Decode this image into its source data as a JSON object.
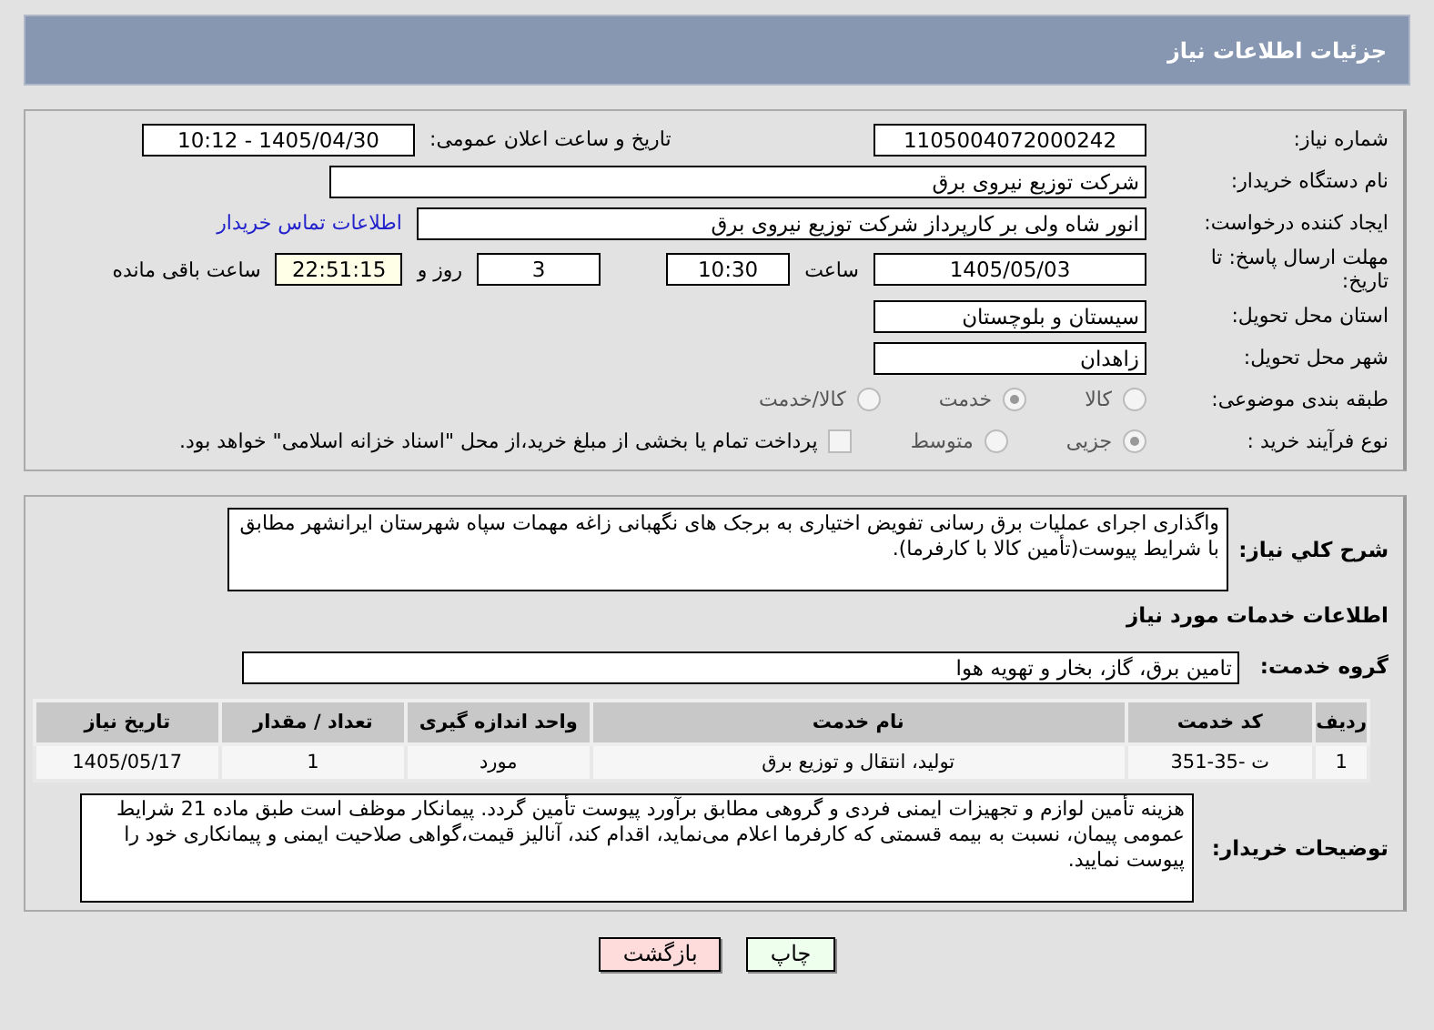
{
  "header": {
    "title": "جزئیات اطلاعات نیاز"
  },
  "need_number": {
    "label": "شماره نیاز:",
    "value": "1105004072000242"
  },
  "announce": {
    "label": "تاریخ و ساعت اعلان عمومی:",
    "value": "1405/04/30 - 10:12"
  },
  "buyer": {
    "label": "نام دستگاه خریدار:",
    "value": "شرکت توزیع نیروی برق"
  },
  "creator": {
    "label": "ایجاد کننده درخواست:",
    "value": "انور شاه ولی بر کارپرداز شرکت توزیع نیروی برق",
    "link": "اطلاعات تماس خریدار"
  },
  "deadline": {
    "label": "مهلت ارسال پاسخ: تا تاریخ:",
    "date": "1405/05/03",
    "time_label": "ساعت",
    "time": "10:30",
    "days": "3",
    "days_label": "روز و",
    "remaining": "22:51:15",
    "remaining_label": "ساعت باقی مانده"
  },
  "province": {
    "label": "استان محل تحویل:",
    "value": "سیستان و بلوچستان"
  },
  "city": {
    "label": "شهر محل تحویل:",
    "value": "زاهدان"
  },
  "category": {
    "label": "طبقه بندی موضوعی:",
    "options": [
      {
        "label": "کالا",
        "selected": false
      },
      {
        "label": "خدمت",
        "selected": true
      },
      {
        "label": "کالا/خدمت",
        "selected": false
      }
    ]
  },
  "process": {
    "label": "نوع فرآیند خرید :",
    "options": [
      {
        "label": "جزیی",
        "selected": true
      },
      {
        "label": "متوسط",
        "selected": false
      }
    ],
    "payment": {
      "label": "پرداخت تمام یا بخشی از مبلغ خرید،از محل \"اسناد خزانه اسلامی\" خواهد بود.",
      "checked": false
    }
  },
  "description": {
    "label": "شرح کلي نیاز:",
    "value": "واگذاری اجرای عملیات برق رسانی تفویض اختیاری به برجک های نگهبانی زاغه مهمات سپاه شهرستان ایرانشهر مطابق با شرایط پیوست(تأمین کالا با کارفرما)."
  },
  "services_heading": "اطلاعات خدمات مورد نیاز",
  "service_group": {
    "label": "گروه خدمت:",
    "value": "تامین برق، گاز، بخار و تهویه هوا"
  },
  "table": {
    "columns": [
      "ردیف",
      "کد خدمت",
      "نام خدمت",
      "واحد اندازه گیری",
      "تعداد / مقدار",
      "تاریخ نیاز"
    ],
    "rows": [
      [
        "1",
        "ت -35-351",
        "تولید، انتقال و توزیع برق",
        "مورد",
        "1",
        "1405/05/17"
      ]
    ]
  },
  "buyer_notes": {
    "label": "توضیحات خریدار:",
    "value": "هزینه تأمین لوازم و تجهیزات ایمنی فردی و گروهی مطابق برآورد پیوست تأمین گردد. پیمانکار موظف است طبق ماده 21 شرایط عمومی پیمان، نسبت به بیمه قسمتی که کارفرما اعلام می‌نماید، اقدام کند، آنالیز قیمت،گواهی صلاحیت ایمنی و پیمانکاری خود را پیوست نمایید."
  },
  "buttons": [
    {
      "label": "چاپ",
      "kind": "print"
    },
    {
      "label": "بازگشت",
      "kind": "back"
    }
  ]
}
